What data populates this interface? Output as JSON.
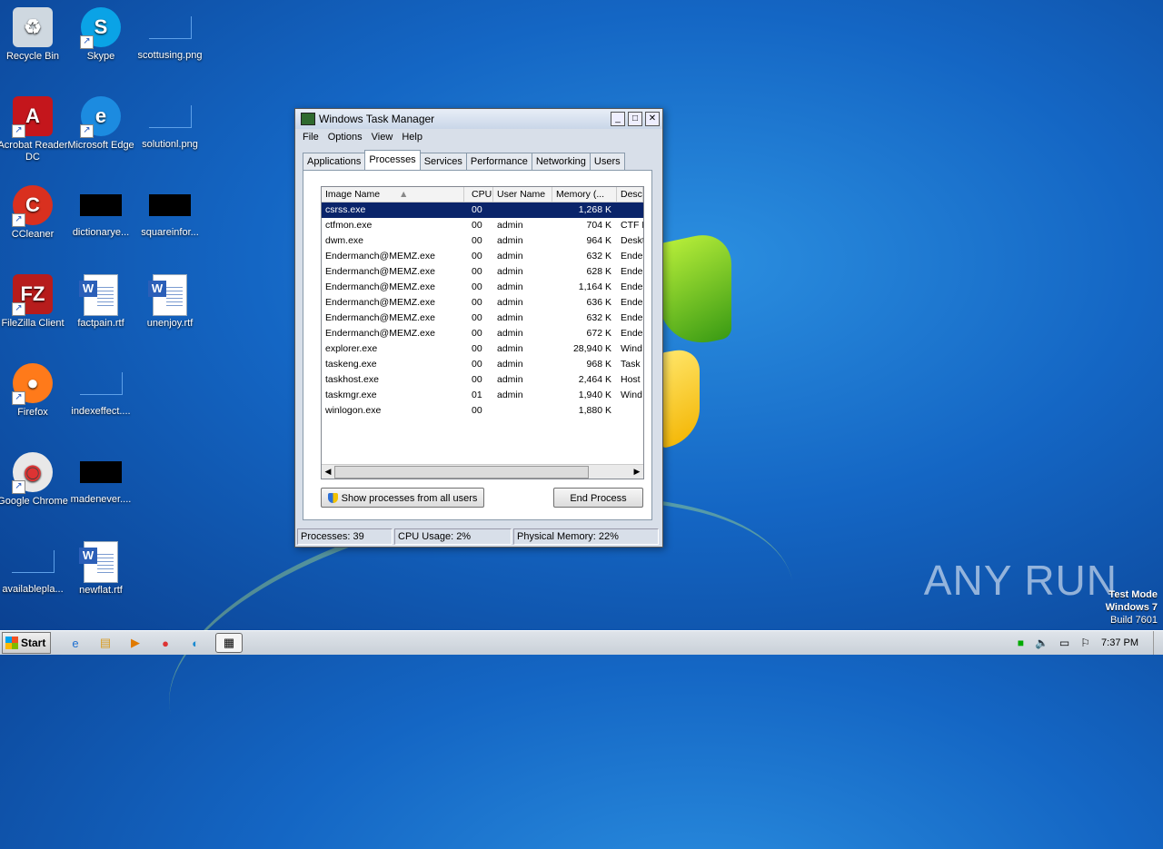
{
  "desktop_icons": [
    {
      "label": "Recycle Bin",
      "icon": "recycle-bin-icon"
    },
    {
      "label": "Skype",
      "icon": "skype-icon"
    },
    {
      "label": "scottusing.png",
      "icon": "image-file-icon"
    },
    {
      "label": "Acrobat Reader DC",
      "icon": "acrobat-icon"
    },
    {
      "label": "Microsoft Edge",
      "icon": "edge-icon"
    },
    {
      "label": "solutionl.png",
      "icon": "image-file-icon"
    },
    {
      "label": "CCleaner",
      "icon": "ccleaner-icon"
    },
    {
      "label": "dictionarye...",
      "icon": "black-file-icon"
    },
    {
      "label": "squareinfor...",
      "icon": "black-file-icon"
    },
    {
      "label": "FileZilla Client",
      "icon": "filezilla-icon"
    },
    {
      "label": "factpain.rtf",
      "icon": "word-doc-icon"
    },
    {
      "label": "unenjoy.rtf",
      "icon": "word-doc-icon"
    },
    {
      "label": "Firefox",
      "icon": "firefox-icon"
    },
    {
      "label": "indexeffect....",
      "icon": "image-file-icon"
    },
    {
      "label": "Google Chrome",
      "icon": "chrome-icon"
    },
    {
      "label": "madenever....",
      "icon": "black-file-icon"
    },
    {
      "label": "availablepla...",
      "icon": "image-file-icon"
    },
    {
      "label": "newflat.rtf",
      "icon": "word-doc-icon"
    }
  ],
  "taskmanager": {
    "title": "Windows Task Manager",
    "menu": [
      "File",
      "Options",
      "View",
      "Help"
    ],
    "tabs": [
      "Applications",
      "Processes",
      "Services",
      "Performance",
      "Networking",
      "Users"
    ],
    "active_tab": "Processes",
    "columns": [
      "Image Name",
      "CPU",
      "User Name",
      "Memory (...",
      "Desc"
    ],
    "rows": [
      [
        "csrss.exe",
        "00",
        "",
        "1,268 K",
        ""
      ],
      [
        "ctfmon.exe",
        "00",
        "admin",
        "704 K",
        "CTF L"
      ],
      [
        "dwm.exe",
        "00",
        "admin",
        "964 K",
        "Deskt"
      ],
      [
        "Endermanch@MEMZ.exe",
        "00",
        "admin",
        "632 K",
        "Ende"
      ],
      [
        "Endermanch@MEMZ.exe",
        "00",
        "admin",
        "628 K",
        "Ende"
      ],
      [
        "Endermanch@MEMZ.exe",
        "00",
        "admin",
        "1,164 K",
        "Ende"
      ],
      [
        "Endermanch@MEMZ.exe",
        "00",
        "admin",
        "636 K",
        "Ende"
      ],
      [
        "Endermanch@MEMZ.exe",
        "00",
        "admin",
        "632 K",
        "Ende"
      ],
      [
        "Endermanch@MEMZ.exe",
        "00",
        "admin",
        "672 K",
        "Ende"
      ],
      [
        "explorer.exe",
        "00",
        "admin",
        "28,940 K",
        "Wind"
      ],
      [
        "taskeng.exe",
        "00",
        "admin",
        "968 K",
        "Task"
      ],
      [
        "taskhost.exe",
        "00",
        "admin",
        "2,464 K",
        "Host"
      ],
      [
        "taskmgr.exe",
        "01",
        "admin",
        "1,940 K",
        "Wind"
      ],
      [
        "winlogon.exe",
        "00",
        "",
        "1,880 K",
        ""
      ]
    ],
    "show_all_label": "Show processes from all users",
    "end_process_label": "End Process",
    "status": {
      "processes": "Processes: 39",
      "cpu": "CPU Usage: 2%",
      "memory": "Physical Memory: 22%"
    }
  },
  "taskbar": {
    "start_label": "Start",
    "clock": "7:37 PM"
  },
  "watermark": "ANY RUN",
  "testmode": {
    "line1": "Test Mode",
    "line2": "Windows 7",
    "line3": "Build 7601"
  }
}
